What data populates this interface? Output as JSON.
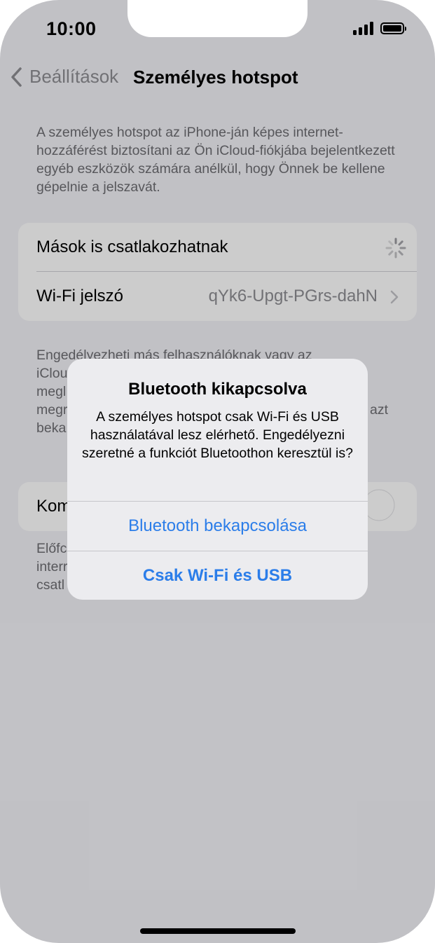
{
  "status_bar": {
    "time": "10:00"
  },
  "nav": {
    "back_label": "Beállítások",
    "title": "Személyes hotspot"
  },
  "intro_text": "A személyes hotspot az iPhone-ján képes internet-hozzáférést biztosítani az Ön iCloud-fiókjába bejelentkezett egyéb eszközök számára anélkül, hogy Önnek be kellene gépelnie a jelszavát.",
  "settings": {
    "allow_others_label": "Mások is csatlakozhatnak",
    "wifi_password_label": "Wi-Fi jelszó",
    "wifi_password_value": "qYk6-Upgt-PGrs-dahN"
  },
  "section2": {
    "description_lines": [
      "Engedélyezheti más felhasználóknak vagy az",
      "iClou",
      "megl",
      "megr",
      "beka"
    ],
    "trailing_fragment": "azt"
  },
  "section3": {
    "row_label_fragment": "Kom",
    "description_lines": [
      "Előfc",
      "interr",
      "csatl"
    ]
  },
  "alert": {
    "title": "Bluetooth kikapcsolva",
    "message": "A személyes hotspot csak Wi-Fi és USB használatával lesz elérhető. Engedélyezni szeretné a funkciót Bluetoothon keresztül is?",
    "button_primary": "Bluetooth bekapcsolása",
    "button_secondary": "Csak Wi-Fi és USB"
  },
  "colors": {
    "accent": "#2b7de9",
    "background": "#f2f2f7",
    "secondary_text": "#6d6d72"
  }
}
